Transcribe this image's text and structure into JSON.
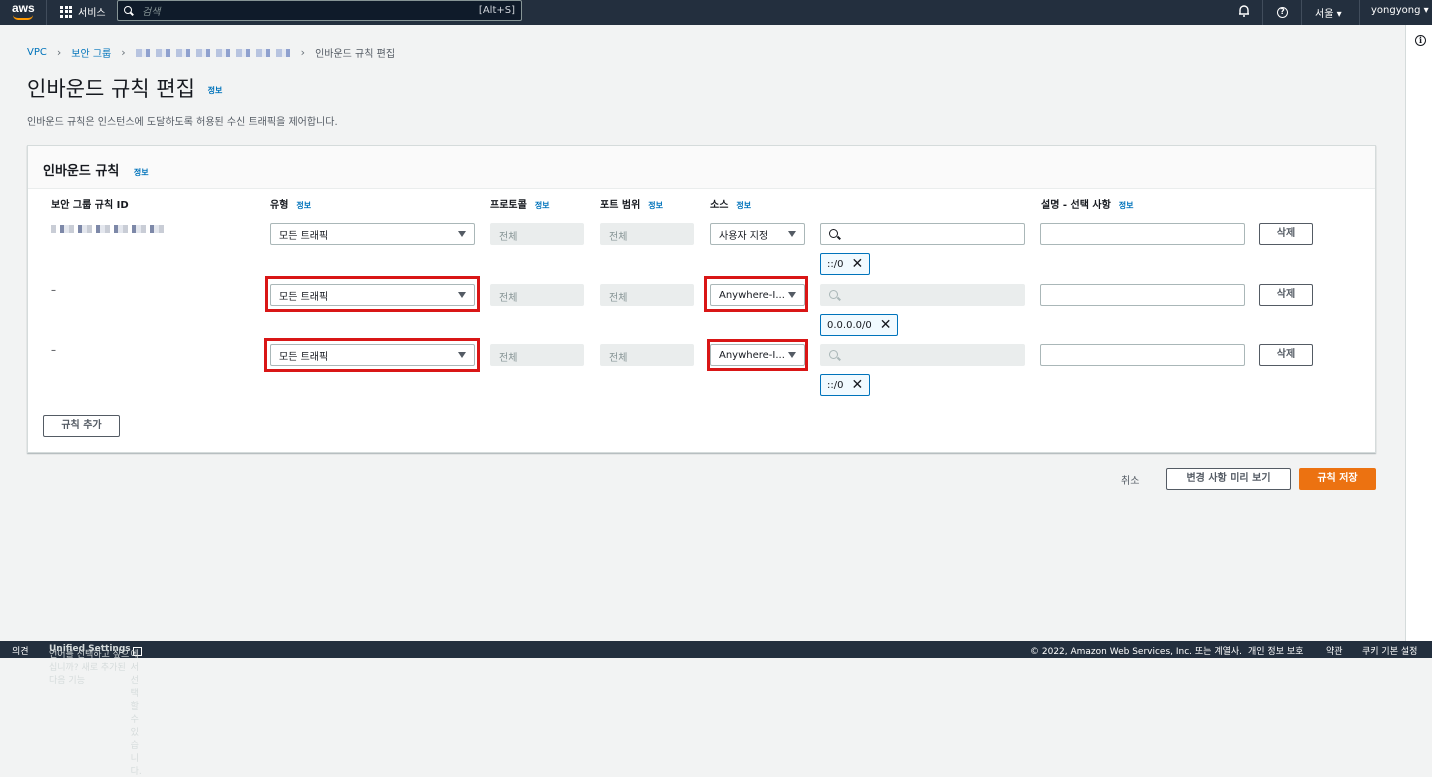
{
  "topbar": {
    "logo": "aws",
    "services_label": "서비스",
    "search_placeholder": "검색",
    "search_shortcut": "[Alt+S]",
    "region": "서울 ▾",
    "user": "yongyong ▾",
    "help_glyph": "?"
  },
  "breadcrumb": {
    "vpc": "VPC",
    "security_groups": "보안 그룹",
    "current": "인바운드 규칙 편집"
  },
  "page": {
    "title": "인바운드 규칙 편집",
    "info": "정보",
    "description": "인바운드 규칙은 인스턴스에 도달하도록 허용된 수신 트래픽을 제어합니다."
  },
  "card": {
    "title": "인바운드 규칙",
    "info": "정보",
    "columns": {
      "rule_id": "보안 그룹 규칙 ID",
      "type": "유형",
      "protocol": "프로토콜",
      "port_range": "포트 범위",
      "source": "소스",
      "description": "설명 - 선택 사항",
      "info": "정보"
    },
    "rows": [
      {
        "rule_id": "",
        "type": "모든 트래픽",
        "protocol": "전체",
        "port": "전체",
        "source": "사용자 지정",
        "token": "::/0",
        "delete": "삭제"
      },
      {
        "rule_id": "–",
        "type": "모든 트래픽",
        "protocol": "전체",
        "port": "전체",
        "source": "Anywhere-I...",
        "token": "0.0.0.0/0",
        "delete": "삭제"
      },
      {
        "rule_id": "–",
        "type": "모든 트래픽",
        "protocol": "전체",
        "port": "전체",
        "source": "Anywhere-I...",
        "token": "::/0",
        "delete": "삭제"
      }
    ],
    "add_rule": "규칙 추가"
  },
  "actions": {
    "cancel": "취소",
    "preview": "변경 사항 미리 보기",
    "save": "규칙 저장"
  },
  "footer": {
    "feedback": "의견",
    "lang_prompt": "언어를 선택하고 싶으십니까? 새로 추가된 다음 기능",
    "unified": "Unified Settings",
    "lang_suffix": "에서 선택할 수 있습니다.",
    "copyright": "© 2022, Amazon Web Services, Inc. 또는 계열사.",
    "privacy": "개인 정보 보호",
    "terms": "약관",
    "cookies": "쿠키 기본 설정"
  },
  "colors": {
    "accent": "#0073bb",
    "primary": "#ec7211",
    "highlight": "#d91616",
    "topbar": "#232f3e"
  }
}
